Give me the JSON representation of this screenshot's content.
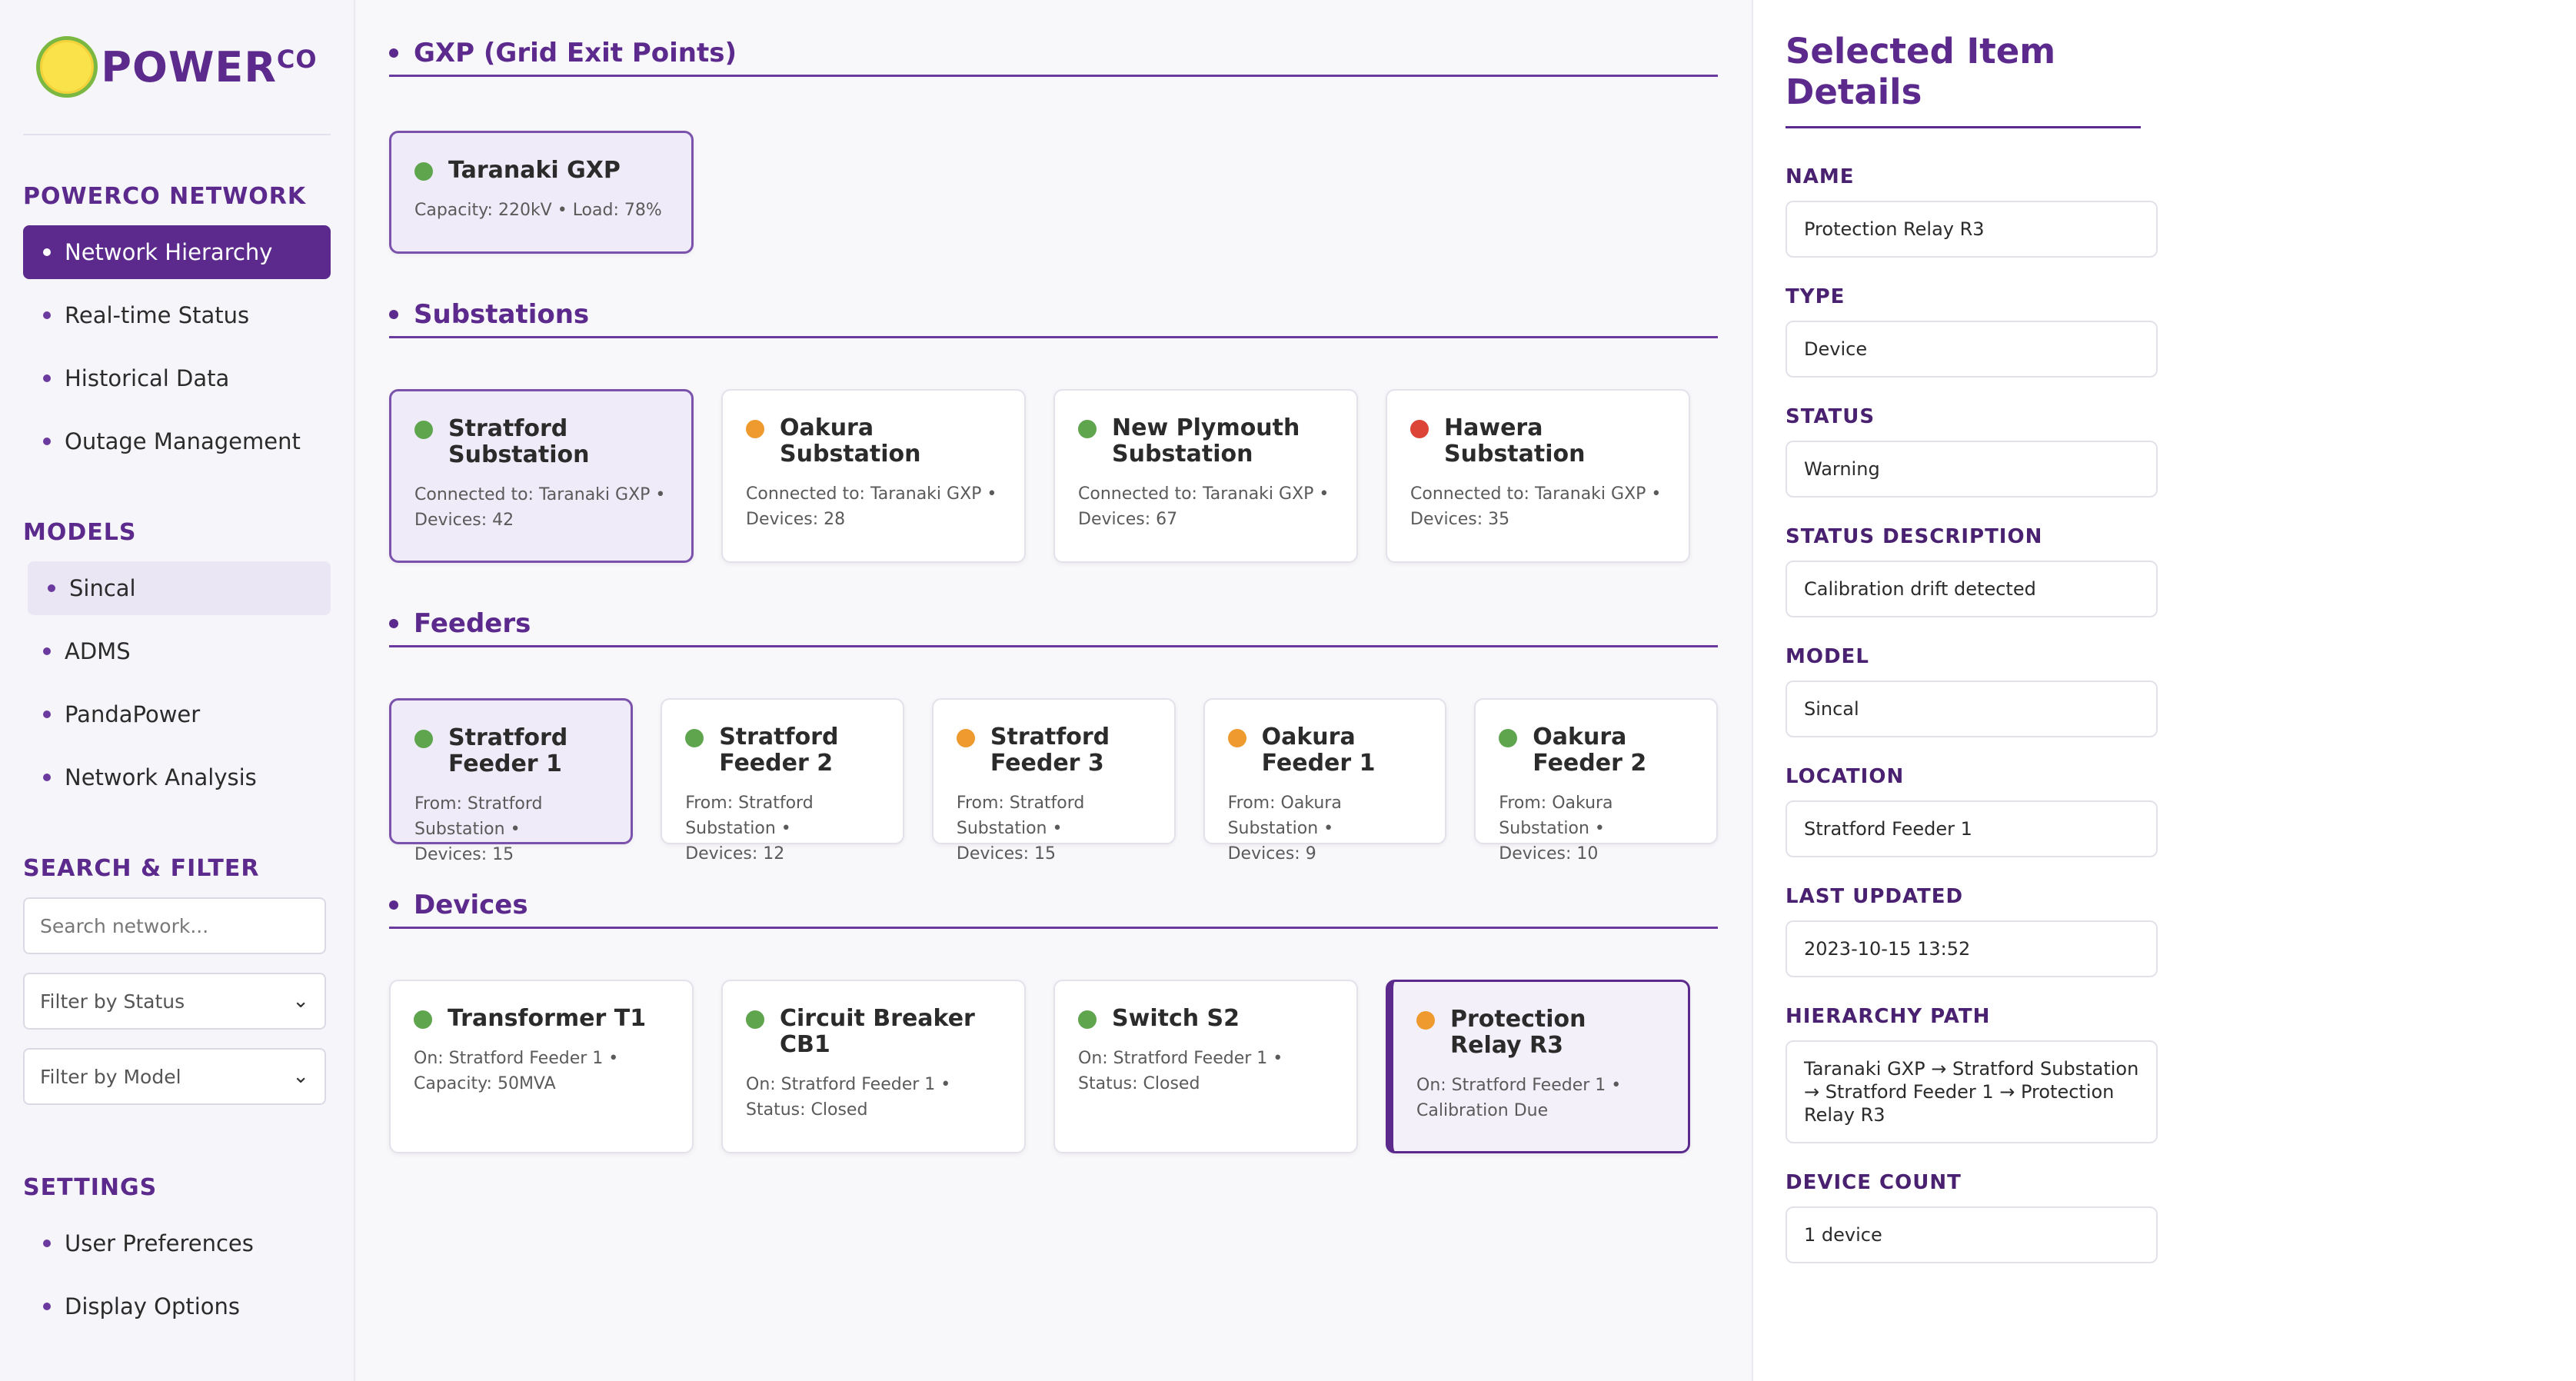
{
  "brand": {
    "logo_text": "POWER",
    "logo_suffix": "CO"
  },
  "sidebar": {
    "network_title": "POWERCO NETWORK",
    "network_items": [
      {
        "label": "Network Hierarchy"
      },
      {
        "label": "Real-time Status"
      },
      {
        "label": "Historical Data"
      },
      {
        "label": "Outage Management"
      }
    ],
    "models_title": "MODELS",
    "model_items": [
      {
        "label": "Sincal"
      },
      {
        "label": "ADMS"
      },
      {
        "label": "PandaPower"
      },
      {
        "label": "Network Analysis"
      }
    ],
    "search_title": "SEARCH & FILTER",
    "search_placeholder": "Search network...",
    "filter_status": "Filter by Status",
    "filter_model": "Filter by Model",
    "settings_title": "SETTINGS",
    "settings_items": [
      {
        "label": "User Preferences"
      },
      {
        "label": "Display Options"
      }
    ]
  },
  "main": {
    "gxp": {
      "title": "GXP (Grid Exit Points)",
      "cards": [
        {
          "name": "Taranaki GXP",
          "meta1": "Capacity: 220kV • Load: 78%",
          "meta2": "",
          "status": "ok"
        }
      ]
    },
    "substations": {
      "title": "Substations",
      "cards": [
        {
          "name": "Stratford Substation",
          "meta1": "Connected to: Taranaki GXP •",
          "meta2": "Devices: 42",
          "status": "ok"
        },
        {
          "name": "Oakura Substation",
          "meta1": "Connected to: Taranaki GXP •",
          "meta2": "Devices: 28",
          "status": "warning"
        },
        {
          "name": "New Plymouth Substation",
          "meta1": "Connected to: Taranaki GXP •",
          "meta2": "Devices: 67",
          "status": "ok"
        },
        {
          "name": "Hawera Substation",
          "meta1": "Connected to: Taranaki GXP •",
          "meta2": "Devices: 35",
          "status": "error"
        }
      ]
    },
    "feeders": {
      "title": "Feeders",
      "cards": [
        {
          "name": "Stratford Feeder 1",
          "meta1": "From: Stratford Substation •",
          "meta2": "Devices: 15",
          "status": "ok"
        },
        {
          "name": "Stratford Feeder 2",
          "meta1": "From: Stratford Substation •",
          "meta2": "Devices: 12",
          "status": "ok"
        },
        {
          "name": "Stratford Feeder 3",
          "meta1": "From: Stratford Substation •",
          "meta2": "Devices: 15",
          "status": "warning"
        },
        {
          "name": "Oakura Feeder 1",
          "meta1": "From: Oakura Substation •",
          "meta2": "Devices: 9",
          "status": "warning"
        },
        {
          "name": "Oakura Feeder 2",
          "meta1": "From: Oakura Substation •",
          "meta2": "Devices: 10",
          "status": "ok"
        }
      ]
    },
    "devices": {
      "title": "Devices",
      "cards": [
        {
          "name": "Transformer T1",
          "meta1": "On: Stratford Feeder 1 •",
          "meta2": "Capacity: 50MVA",
          "status": "ok"
        },
        {
          "name": "Circuit Breaker CB1",
          "meta1": "On: Stratford Feeder 1 •",
          "meta2": "Status: Closed",
          "status": "ok"
        },
        {
          "name": "Switch S2",
          "meta1": "On: Stratford Feeder 1 •",
          "meta2": "Status: Closed",
          "status": "ok"
        },
        {
          "name": "Protection Relay R3",
          "meta1": "On: Stratford Feeder 1 •",
          "meta2": "Calibration Due",
          "status": "warning"
        }
      ]
    }
  },
  "details": {
    "title": "Selected Item Details",
    "fields": [
      {
        "label": "NAME",
        "value": "Protection Relay R3"
      },
      {
        "label": "TYPE",
        "value": "Device"
      },
      {
        "label": "STATUS",
        "value": "Warning"
      },
      {
        "label": "STATUS DESCRIPTION",
        "value": "Calibration drift detected"
      },
      {
        "label": "MODEL",
        "value": "Sincal"
      },
      {
        "label": "LOCATION",
        "value": "Stratford Feeder 1"
      },
      {
        "label": "LAST UPDATED",
        "value": "2023-10-15 13:52"
      },
      {
        "label": "HIERARCHY PATH",
        "value": "Taranaki GXP → Stratford Substation → Stratford Feeder 1 → Protection Relay R3"
      },
      {
        "label": "DEVICE COUNT",
        "value": "1 device"
      }
    ]
  },
  "colors": {
    "brand": "#5b2a8c",
    "status_ok": "#5ea54e",
    "status_warning": "#ee9a2e",
    "status_error": "#db4436"
  }
}
